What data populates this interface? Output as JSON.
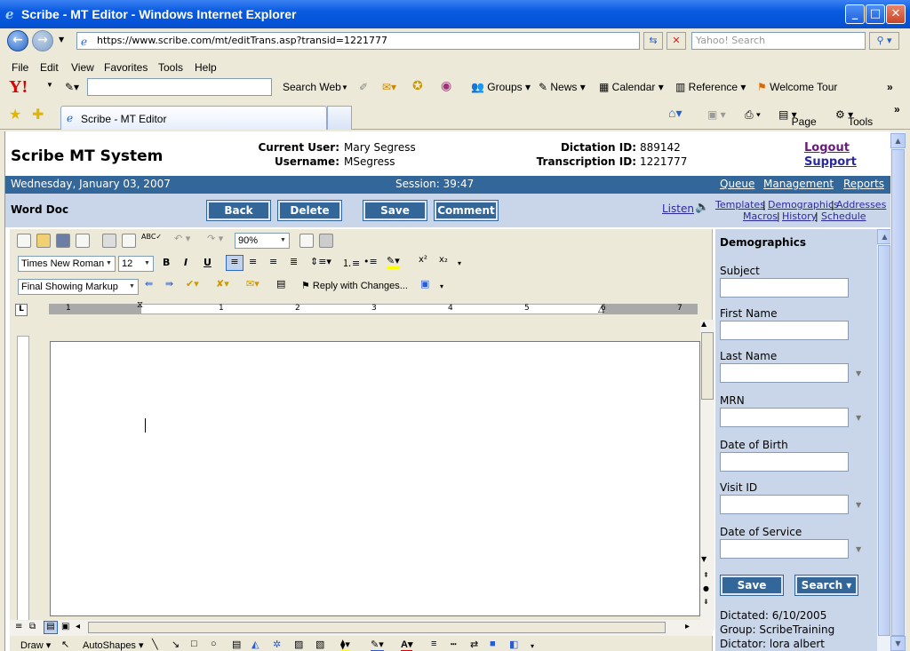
{
  "window": {
    "title": "Scribe - MT Editor - Windows Internet Explorer"
  },
  "address": {
    "url": "https://www.scribe.com/mt/editTrans.asp?transid=1221777",
    "search_placeholder": "Yahoo! Search"
  },
  "menu": [
    "File",
    "Edit",
    "View",
    "Favorites",
    "Tools",
    "Help"
  ],
  "yahoo_toolbar": {
    "search_btn": "Search Web",
    "items": [
      "Groups",
      "News",
      "Calendar",
      "Reference",
      "Welcome Tour"
    ]
  },
  "tab": {
    "title": "Scribe - MT Editor",
    "page": "Page",
    "tools": "Tools"
  },
  "header": {
    "app_name": "Scribe MT System",
    "current_user_label": "Current User:",
    "current_user": "Mary Segress",
    "username_label": "Username:",
    "username": "MSegress",
    "dictation_label": "Dictation ID:",
    "dictation_id": "889142",
    "transcription_label": "Transcription ID:",
    "transcription_id": "1221777",
    "logout": "Logout",
    "support": "Support"
  },
  "datebar": {
    "date": "Wednesday, January 03, 2007",
    "session": "Session: 39:47",
    "links": [
      "Queue",
      "Management",
      "Reports"
    ]
  },
  "actionbar": {
    "title": "Word Doc",
    "buttons": [
      "Back",
      "Delete",
      "Save",
      "Comment"
    ],
    "listen": "Listen",
    "links": [
      "Templates",
      "Demographics",
      "Addresses",
      "Macros",
      "History",
      "Schedule"
    ]
  },
  "word": {
    "zoom": "90%",
    "font": "Times New Roman",
    "size": "12",
    "markup": "Final Showing Markup",
    "reply": "Reply with Changes...",
    "ruler": [
      "1",
      "1",
      "2",
      "3",
      "4",
      "5",
      "6",
      "7"
    ],
    "draw": "Draw",
    "autoshapes": "AutoShapes"
  },
  "demographics": {
    "title": "Demographics",
    "fields": [
      "Subject",
      "First Name",
      "Last Name",
      "MRN",
      "Date of Birth",
      "Visit ID",
      "Date of Service"
    ],
    "save": "Save",
    "search": "Search",
    "dictated": "Dictated: 6/10/2005",
    "group": "Group: ScribeTraining",
    "dictator": "Dictator: lora albert"
  }
}
